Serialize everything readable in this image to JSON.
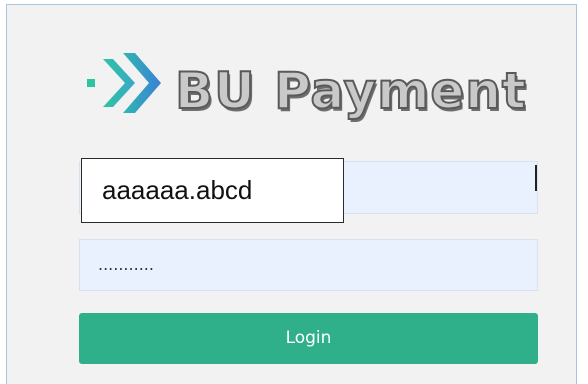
{
  "logo": {
    "text": "BU Payment",
    "icon": "double-chevron-arrow-icon",
    "colors": {
      "teal": "#2fc4a0",
      "blue": "#3b86d6"
    }
  },
  "form": {
    "username_value": "aaaaaa.abcd",
    "password_masked": "...........",
    "login_label": "Login"
  },
  "colors": {
    "window_bg": "#f2f2f3",
    "input_bg": "#e9f0fe",
    "button_bg": "#2fb08b"
  }
}
